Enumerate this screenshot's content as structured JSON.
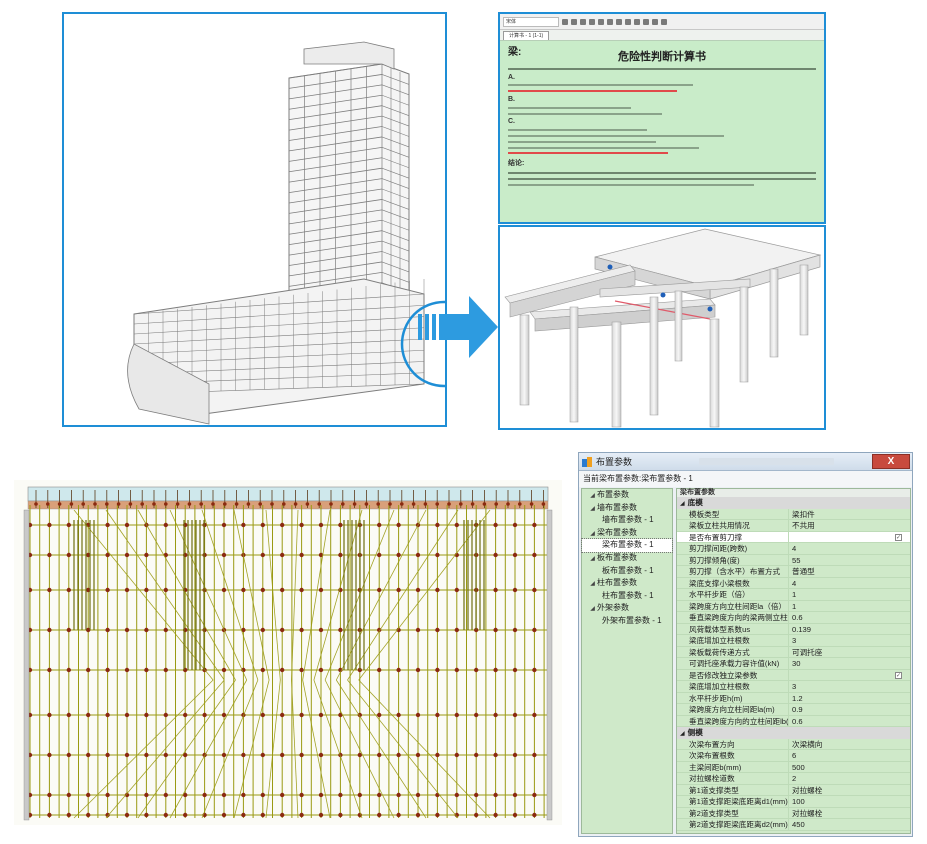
{
  "colors": {
    "panel_border": "#1e8ed6",
    "report_bg": "#c9ecc9",
    "scaffold_yellow": "#9a9a12",
    "scaffold_node": "#8b2a10"
  },
  "report": {
    "tab": "计算书 - 1 (1-1)",
    "mark": "梁:",
    "title": "危险性判断计算书",
    "sections": [
      "A.",
      "B.",
      "C."
    ],
    "conclusion_label": "结论:"
  },
  "dialog": {
    "title": "布置参数",
    "close_label": "X",
    "current_label": "当前梁布置参数:梁布置参数 - 1",
    "tree": [
      {
        "label": "布置参数",
        "level": 1,
        "expanded": true
      },
      {
        "label": "墙布置参数",
        "level": 1,
        "expanded": true
      },
      {
        "label": "墙布置参数 - 1",
        "level": 2
      },
      {
        "label": "梁布置参数",
        "level": 1,
        "expanded": true
      },
      {
        "label": "梁布置参数 - 1",
        "level": 2,
        "selected": true
      },
      {
        "label": "板布置参数",
        "level": 1,
        "expanded": true
      },
      {
        "label": "板布置参数 - 1",
        "level": 2
      },
      {
        "label": "柱布置参数",
        "level": 1,
        "expanded": true
      },
      {
        "label": "柱布置参数 - 1",
        "level": 2
      },
      {
        "label": "外架参数",
        "level": 1,
        "expanded": true
      },
      {
        "label": "外架布置参数 - 1",
        "level": 2
      }
    ],
    "grid_header": "梁布置参数",
    "categories": [
      {
        "name": "底模",
        "rows": [
          {
            "name": "模板类型",
            "value": "梁扣件"
          },
          {
            "name": "梁板立柱共用情况",
            "value": "不共用"
          },
          {
            "name": "是否布置剪刀撑",
            "value": "",
            "check": true
          },
          {
            "name": "剪刀撑间距(跨数)",
            "value": "4"
          },
          {
            "name": "剪刀撑倾角(度)",
            "value": "55"
          },
          {
            "name": "剪刀撑（含水平）布置方式",
            "value": "普通型"
          },
          {
            "name": "梁底支撑小梁根数",
            "value": "4"
          },
          {
            "name": "水平杆步距（倍）",
            "value": "1"
          },
          {
            "name": "梁跨度方向立柱间距la（倍）",
            "value": "1"
          },
          {
            "name": "垂直梁跨度方向的梁两侧立柱间距lb(m)",
            "value": "0.6"
          },
          {
            "name": "风荷载体型系数us",
            "value": "0.139"
          },
          {
            "name": "梁底增加立柱根数",
            "value": "3"
          },
          {
            "name": "梁板载荷传递方式",
            "value": "可调托座"
          },
          {
            "name": "可调托座承载力容许值(kN)",
            "value": "30"
          },
          {
            "name": "是否修改独立梁参数",
            "value": "",
            "check": true
          },
          {
            "name": "梁底增加立柱根数",
            "value": "3"
          },
          {
            "name": "水平杆步距h(m)",
            "value": "1.2"
          },
          {
            "name": "梁跨度方向立柱间距la(m)",
            "value": "0.9"
          },
          {
            "name": "垂直梁跨度方向的立柱间距lb(m)",
            "value": "0.6"
          }
        ]
      },
      {
        "name": "侧模",
        "rows": [
          {
            "name": "次梁布置方向",
            "value": "次梁横向"
          },
          {
            "name": "次梁布置根数",
            "value": "6"
          },
          {
            "name": "主梁间距b(mm)",
            "value": "500"
          },
          {
            "name": "对拉螺栓道数",
            "value": "2"
          },
          {
            "name": "第1道支撑类型",
            "value": "对拉螺栓"
          },
          {
            "name": "第1道支撑距梁底距离d1(mm)",
            "value": "100"
          },
          {
            "name": "第2道支撑类型",
            "value": "对拉螺栓"
          },
          {
            "name": "第2道支撑距梁底距离d2(mm)",
            "value": "450"
          }
        ]
      }
    ]
  }
}
